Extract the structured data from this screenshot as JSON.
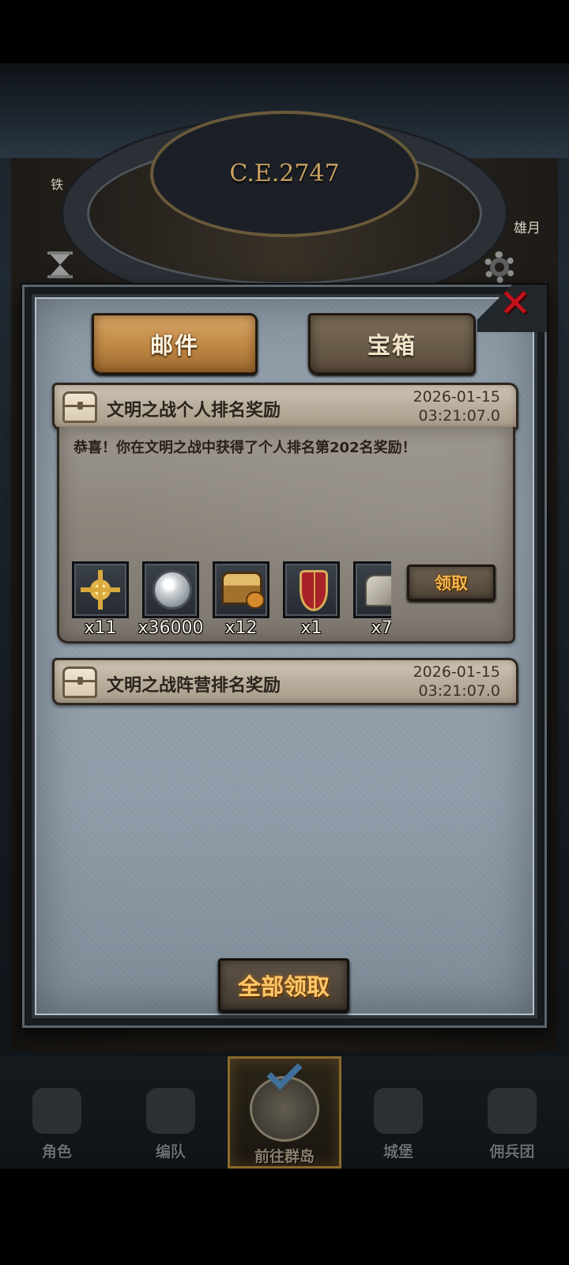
{
  "background": {
    "year": "C.E.2747",
    "left_label": "铁",
    "right_label": "雄月"
  },
  "tabs": [
    {
      "label": "邮件",
      "active": true
    },
    {
      "label": "宝箱",
      "active": false
    }
  ],
  "close_icon": "close-x-icon",
  "mails": [
    {
      "title": "文明之战个人排名奖励",
      "date": "2026-01-15",
      "time": "03:21:07.0",
      "expanded": true,
      "message": "恭喜！你在文明之战中获得了个人排名第202名奖励！",
      "rewards": [
        {
          "icon": "sun-emblem-icon",
          "count": "x11"
        },
        {
          "icon": "silver-coin-icon",
          "count": "x36000"
        },
        {
          "icon": "treasure-chest-bag-icon",
          "count": "x12"
        },
        {
          "icon": "shield-icon",
          "count": "x1"
        },
        {
          "icon": "stone-icon",
          "count": "x7"
        }
      ],
      "claim_label": "领取"
    },
    {
      "title": "文明之战阵营排名奖励",
      "date": "2026-01-15",
      "time": "03:21:07.0",
      "expanded": false
    }
  ],
  "claim_all_label": "全部领取",
  "bottom_nav": [
    {
      "label": "角色",
      "icon": "knight-icon",
      "active": false
    },
    {
      "label": "编队",
      "icon": "helmet-icon",
      "active": false
    },
    {
      "label": "前往群岛",
      "icon": "globe-compass-icon",
      "active": true
    },
    {
      "label": "城堡",
      "icon": "castle-icon",
      "active": false
    },
    {
      "label": "佣兵团",
      "icon": "ship-icon",
      "active": false
    }
  ],
  "colors": {
    "tab_active": "#bf8744",
    "tab_inactive": "#6a5c4a",
    "claim_text": "#f6b64e",
    "close_red": "#c4121a"
  }
}
